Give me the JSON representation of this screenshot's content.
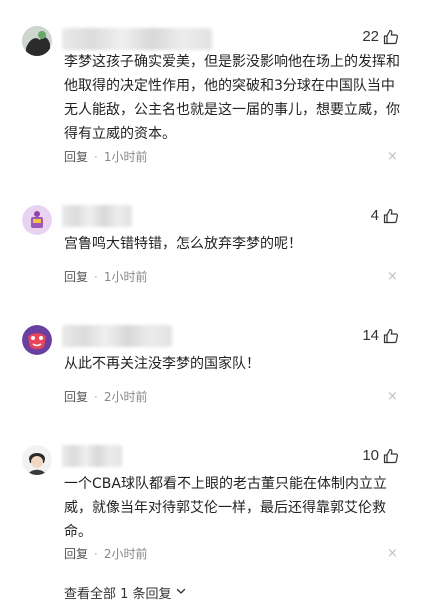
{
  "comments": [
    {
      "likes": "22",
      "text": "李梦这孩子确实爱美，但是影没影响他在场上的发挥和他取得的决定性作用，他的突破和3分球在中国队当中无人能敌，公主名也就是这一届的事儿，想要立威，你得有立威的资本。",
      "reply_label": "回复",
      "time": "1小时前",
      "close_glyph": "×"
    },
    {
      "likes": "4",
      "text": "宫鲁鸣大错特错，怎么放弃李梦的呢！",
      "reply_label": "回复",
      "time": "1小时前",
      "close_glyph": "×"
    },
    {
      "likes": "14",
      "text": "从此不再关注没李梦的国家队！",
      "reply_label": "回复",
      "time": "2小时前",
      "close_glyph": "×"
    },
    {
      "likes": "10",
      "text": "一个CBA球队都看不上眼的老古董只能在体制内立立威，就像当年对待郭艾伦一样，最后还得靠郭艾伦救命。",
      "reply_label": "回复",
      "time": "2小时前",
      "close_glyph": "×"
    }
  ],
  "footer": {
    "view_all_label": "查看全部 1 条回复",
    "chevron_icon": "chevron-down-icon"
  },
  "icons": {
    "like": "thumbs-up-icon",
    "close": "close-icon"
  }
}
